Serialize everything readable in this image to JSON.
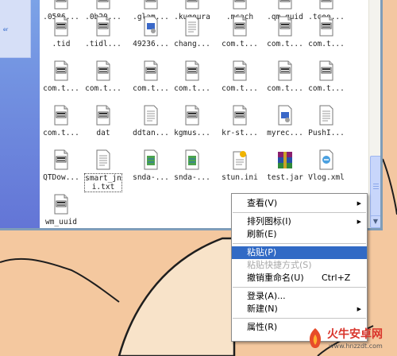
{
  "colors": {
    "selection_blue": "#316ac5",
    "taskpane_blue": "#6375d6",
    "wallpaper_peach": "#f3c7a1",
    "disabled_gray": "#a7a7a7"
  },
  "files": [
    {
      "name": ".0586...",
      "icon": "file-icon"
    },
    {
      "name": ".0b20...",
      "icon": "file-icon"
    },
    {
      "name": ".glam...",
      "icon": "file-icon"
    },
    {
      "name": ".kugoura",
      "icon": "file-icon"
    },
    {
      "name": ".mcach",
      "icon": "file-icon"
    },
    {
      "name": ".qm_guid",
      "icon": "file-icon"
    },
    {
      "name": ".tcoo...",
      "icon": "file-icon"
    },
    {
      "name": ".tid",
      "icon": "unknown-file-icon"
    },
    {
      "name": ".tidl...",
      "icon": "unknown-file-icon"
    },
    {
      "name": "49236...",
      "icon": "media-file-icon"
    },
    {
      "name": "chang...",
      "icon": "text-file-icon"
    },
    {
      "name": "com.t...",
      "icon": "unknown-file-icon"
    },
    {
      "name": "com.t...",
      "icon": "unknown-file-icon"
    },
    {
      "name": "com.t...",
      "icon": "unknown-file-icon"
    },
    {
      "name": "com.t...",
      "icon": "unknown-file-icon"
    },
    {
      "name": "com.t...",
      "icon": "unknown-file-icon"
    },
    {
      "name": "com.t...",
      "icon": "unknown-file-icon"
    },
    {
      "name": "com.t...",
      "icon": "unknown-file-icon"
    },
    {
      "name": "com.t...",
      "icon": "unknown-file-icon"
    },
    {
      "name": "com.t...",
      "icon": "unknown-file-icon"
    },
    {
      "name": "com.t...",
      "icon": "unknown-file-icon"
    },
    {
      "name": "com.t...",
      "icon": "unknown-file-icon"
    },
    {
      "name": "dat",
      "icon": "unknown-file-icon"
    },
    {
      "name": "ddtan...",
      "icon": "text-file-icon"
    },
    {
      "name": "kgmus...",
      "icon": "unknown-file-icon"
    },
    {
      "name": "kr-st...",
      "icon": "unknown-file-icon"
    },
    {
      "name": "myrec...",
      "icon": "media-file-icon"
    },
    {
      "name": "PushI...",
      "icon": "text-file-icon"
    },
    {
      "name": "QTDow...",
      "icon": "unknown-file-icon"
    },
    {
      "name": "smart_jni.txt",
      "icon": "text-file-icon",
      "selected": true
    },
    {
      "name": "snda-...",
      "icon": "script-file-icon"
    },
    {
      "name": "snda-...",
      "icon": "script-file-icon"
    },
    {
      "name": "stun.ini",
      "icon": "ini-file-icon"
    },
    {
      "name": "test.jar",
      "icon": "winrar-archive-icon"
    },
    {
      "name": "Vlog.xml",
      "icon": "xml-file-icon"
    },
    {
      "name": "wm_uuid",
      "icon": "unknown-file-icon"
    }
  ],
  "context_menu": {
    "view": "查看(V)",
    "arrange_icons": "排列图标(I)",
    "refresh": "刷新(E)",
    "paste": "粘贴(P)",
    "paste_shortcut": "粘贴快捷方式(S)",
    "undo_rename": "撤销重命名(U)",
    "undo_rename_shortcut": "Ctrl+Z",
    "login": "登录(A)...",
    "new": "新建(N)",
    "properties": "属性(R)"
  },
  "taskpane": {
    "text": "er"
  },
  "watermark": {
    "brand": "火牛安卓网",
    "url": "www.hnzzdt.com"
  }
}
